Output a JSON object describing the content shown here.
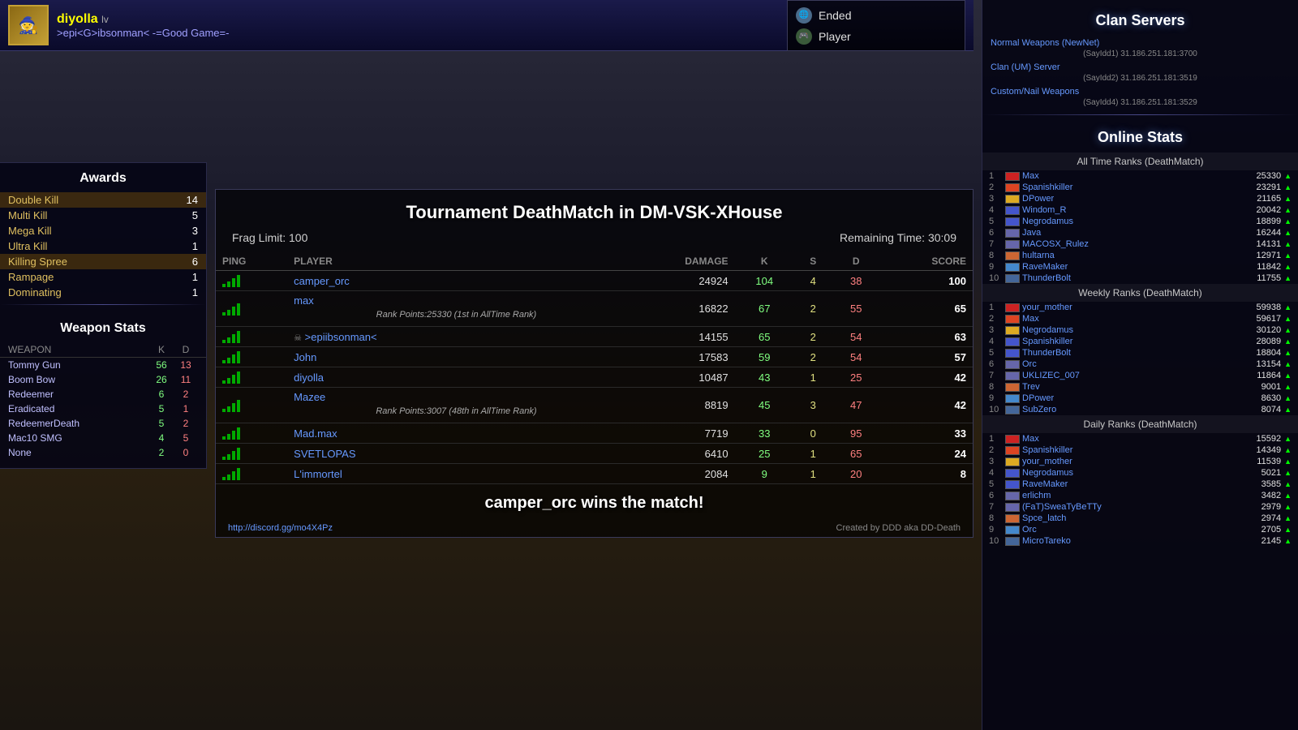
{
  "topBar": {
    "playerName": "diyolla",
    "playerLevel": "lv",
    "chatMessage": ">epi<G>ibsonman< -=Good Game=-"
  },
  "statusPanel": {
    "ended": "Ended",
    "player": "Player"
  },
  "clanServers": {
    "title": "Clan Servers",
    "servers": [
      {
        "name": "Normal Weapons (NewNet)",
        "addr": "(SayIdd1) 31.186.251.181:3700"
      },
      {
        "name": "Clan (UM) Server",
        "addr": "(SayIdd2) 31.186.251.181:3519"
      },
      {
        "name": "Custom/Nail Weapons",
        "addr": "(SayIdd4) 31.186.251.181:3529"
      }
    ]
  },
  "onlineStats": {
    "title": "Online Stats",
    "allTimeTitle": "All Time Ranks (DeathMatch)",
    "allTime": [
      {
        "rank": 1,
        "name": "Max",
        "score": 25330
      },
      {
        "rank": 2,
        "name": "Spanishkiller",
        "score": 23291
      },
      {
        "rank": 3,
        "name": "DPower",
        "score": 21165
      },
      {
        "rank": 4,
        "name": "Windom_R",
        "score": 20042
      },
      {
        "rank": 5,
        "name": "Negrodamus",
        "score": 18899
      },
      {
        "rank": 6,
        "name": "Java",
        "score": 16244
      },
      {
        "rank": 7,
        "name": "MACOSX_Rulez",
        "score": 14131
      },
      {
        "rank": 8,
        "name": "hultarna",
        "score": 12971
      },
      {
        "rank": 9,
        "name": "RaveMaker",
        "score": 11842
      },
      {
        "rank": 10,
        "name": "ThunderBolt",
        "score": 11755
      }
    ],
    "weeklyTitle": "Weekly Ranks (DeathMatch)",
    "weekly": [
      {
        "rank": 1,
        "name": "your_mother",
        "score": 59938
      },
      {
        "rank": 2,
        "name": "Max",
        "score": 59617
      },
      {
        "rank": 3,
        "name": "Negrodamus",
        "score": 30120
      },
      {
        "rank": 4,
        "name": "Spanishkiller",
        "score": 28089
      },
      {
        "rank": 5,
        "name": "ThunderBolt",
        "score": 18804
      },
      {
        "rank": 6,
        "name": "Orc",
        "score": 13154
      },
      {
        "rank": 7,
        "name": "UKLIZEC_007",
        "score": 11864
      },
      {
        "rank": 8,
        "name": "Trev",
        "score": 9001
      },
      {
        "rank": 9,
        "name": "DPower",
        "score": 8630
      },
      {
        "rank": 10,
        "name": "SubZero",
        "score": 8074
      }
    ],
    "dailyTitle": "Daily Ranks (DeathMatch)",
    "daily": [
      {
        "rank": 1,
        "name": "Max",
        "score": 15592
      },
      {
        "rank": 2,
        "name": "Spanishkiller",
        "score": 14349
      },
      {
        "rank": 3,
        "name": "your_mother",
        "score": 11539
      },
      {
        "rank": 4,
        "name": "Negrodamus",
        "score": 5021
      },
      {
        "rank": 5,
        "name": "RaveMaker",
        "score": 3585
      },
      {
        "rank": 6,
        "name": "erlichm",
        "score": 3482
      },
      {
        "rank": 7,
        "name": "(FaT)SweaTyBeTTy",
        "score": 2979
      },
      {
        "rank": 8,
        "name": "Spce_latch",
        "score": 2974
      },
      {
        "rank": 9,
        "name": "Orc",
        "score": 2705
      },
      {
        "rank": 10,
        "name": "MicroTareko",
        "score": 2145
      }
    ]
  },
  "awards": {
    "title": "Awards",
    "items": [
      {
        "name": "Double Kill",
        "count": 14,
        "highlight": true
      },
      {
        "name": "Multi Kill",
        "count": 5,
        "highlight": false
      },
      {
        "name": "Mega Kill",
        "count": 3,
        "highlight": false
      },
      {
        "name": "Ultra Kill",
        "count": 1,
        "highlight": false
      },
      {
        "name": "Killing Spree",
        "count": 6,
        "highlight": true
      },
      {
        "name": "Rampage",
        "count": 1,
        "highlight": false
      },
      {
        "name": "Dominating",
        "count": 1,
        "highlight": false
      }
    ]
  },
  "weaponStats": {
    "title": "Weapon Stats",
    "headers": {
      "weapon": "WEAPON",
      "k": "K",
      "d": "D"
    },
    "items": [
      {
        "name": "Tommy Gun",
        "k": 56,
        "d": 13
      },
      {
        "name": "Boom Bow",
        "k": 26,
        "d": 11
      },
      {
        "name": "Redeemer",
        "k": 6,
        "d": 2
      },
      {
        "name": "Eradicated",
        "k": 5,
        "d": 1
      },
      {
        "name": "RedeemerDeath",
        "k": 5,
        "d": 2
      },
      {
        "name": "Mac10 SMG",
        "k": 4,
        "d": 5
      },
      {
        "name": "None",
        "k": 2,
        "d": 0
      }
    ]
  },
  "scoreboard": {
    "title": "Tournament DeathMatch in DM-VSK-XHouse",
    "fragLimit": "Frag Limit: 100",
    "remainingTime": "Remaining Time: 30:09",
    "headers": {
      "ping": "PING",
      "player": "PLAYER",
      "damage": "DAMAGE",
      "k": "K",
      "s": "S",
      "d": "D",
      "score": "SCORE"
    },
    "players": [
      {
        "name": "camper_orc",
        "ping": 3,
        "damage": 24924,
        "k": 104,
        "s": 4,
        "d": 38,
        "score": 100,
        "skull": false,
        "rankTooltip": ""
      },
      {
        "name": "max",
        "ping": 3,
        "damage": 16822,
        "k": 67,
        "s": 2,
        "d": 55,
        "score": 65,
        "skull": false,
        "rankTooltip": "Rank Points:25330 (1st in AllTime Rank)"
      },
      {
        "name": ">epi<G>ibsonman<",
        "ping": 3,
        "damage": 14155,
        "k": 65,
        "s": 2,
        "d": 54,
        "score": 63,
        "skull": true,
        "rankTooltip": ""
      },
      {
        "name": "John",
        "ping": 3,
        "damage": 17583,
        "k": 59,
        "s": 2,
        "d": 54,
        "score": 57,
        "skull": false,
        "rankTooltip": ""
      },
      {
        "name": "diyolla",
        "ping": 3,
        "damage": 10487,
        "k": 43,
        "s": 1,
        "d": 25,
        "score": 42,
        "skull": false,
        "rankTooltip": ""
      },
      {
        "name": "Mazee",
        "ping": 3,
        "damage": 8819,
        "k": 45,
        "s": 3,
        "d": 47,
        "score": 42,
        "skull": false,
        "rankTooltip": "Rank Points:3007 (48th in AllTime Rank)"
      },
      {
        "name": "Mad.max",
        "ping": 3,
        "damage": 7719,
        "k": 33,
        "s": 0,
        "d": 95,
        "score": 33,
        "skull": false,
        "rankTooltip": ""
      },
      {
        "name": "SVETLOPAS",
        "ping": 3,
        "damage": 6410,
        "k": 25,
        "s": 1,
        "d": 65,
        "score": 24,
        "skull": false,
        "rankTooltip": ""
      },
      {
        "name": "L'immortel",
        "ping": 3,
        "damage": 2084,
        "k": 9,
        "s": 1,
        "d": 20,
        "score": 8,
        "skull": false,
        "rankTooltip": ""
      }
    ],
    "winner": "camper_orc wins the match!",
    "discordLink": "http://discord.gg/mo4X4Pz",
    "createdBy": "Created by DDD aka DD-Death"
  }
}
